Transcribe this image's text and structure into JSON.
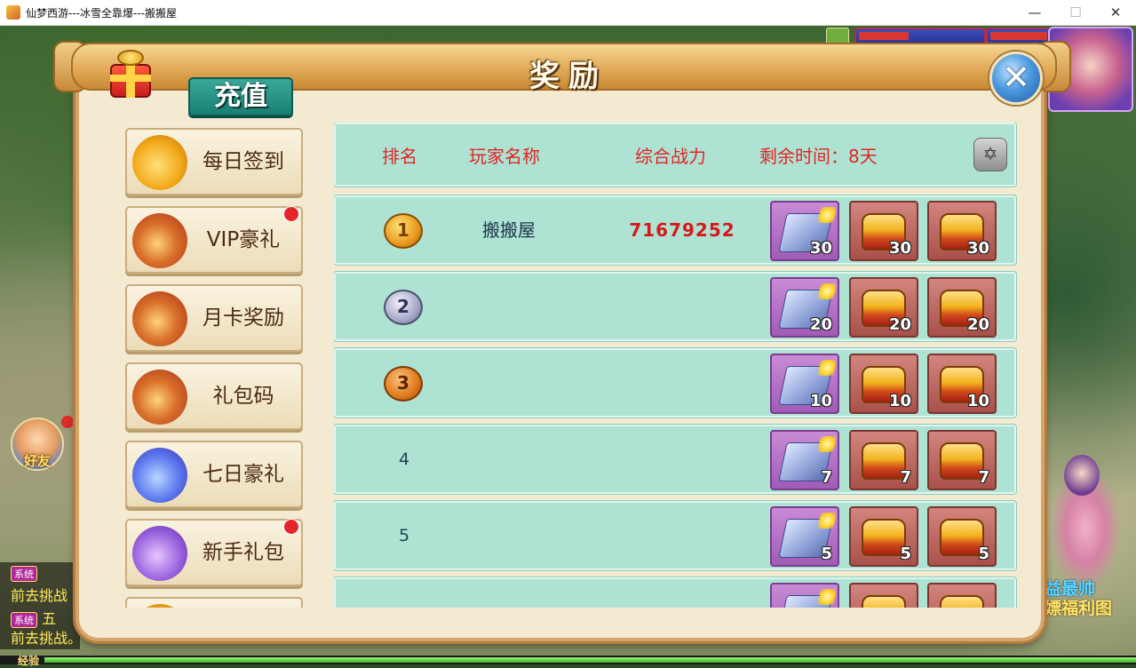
{
  "window": {
    "title": "仙梦西游---冰雪全靠爆---搬搬屋",
    "minimize": "—",
    "maximize": "☐",
    "close": "✕"
  },
  "panel": {
    "title": "奖励",
    "recharge_label": "充值",
    "close_glyph": "✕"
  },
  "menu": [
    {
      "label": "每日签到",
      "icon": "money-bag-icon",
      "badge": false
    },
    {
      "label": "VIP豪礼",
      "icon": "lucky-bag-icon",
      "badge": true
    },
    {
      "label": "月卡奖励",
      "icon": "lucky-bag-icon",
      "badge": false
    },
    {
      "label": "礼包码",
      "icon": "lucky-bag-icon",
      "badge": false
    },
    {
      "label": "七日豪礼",
      "icon": "blue-bag-icon",
      "badge": false
    },
    {
      "label": "新手礼包",
      "icon": "purple-bag-icon",
      "badge": true
    }
  ],
  "table": {
    "headers": {
      "rank": "排名",
      "name": "玩家名称",
      "power": "综合战力",
      "time": "剩余时间：8天"
    },
    "settings_glyph": "✡",
    "rows": [
      {
        "rank": "1",
        "name": "搬搬屋",
        "power": "71679252",
        "rewards": [
          "30",
          "30",
          "30"
        ]
      },
      {
        "rank": "2",
        "name": "",
        "power": "",
        "rewards": [
          "20",
          "20",
          "20"
        ]
      },
      {
        "rank": "3",
        "name": "",
        "power": "",
        "rewards": [
          "10",
          "10",
          "10"
        ]
      },
      {
        "rank": "4",
        "name": "",
        "power": "",
        "rewards": [
          "7",
          "7",
          "7"
        ]
      },
      {
        "rank": "5",
        "name": "",
        "power": "",
        "rewards": [
          "5",
          "5",
          "5"
        ]
      }
    ]
  },
  "hud": {
    "friend_label": "好友",
    "right_text_1": "益最帅",
    "right_text_2": "嫖福利图",
    "chat_tag": "系统",
    "chat_line_1": "前去挑战",
    "chat_line_2": "五",
    "chat_line_3": "前去挑战。",
    "exp_label": "经验"
  }
}
